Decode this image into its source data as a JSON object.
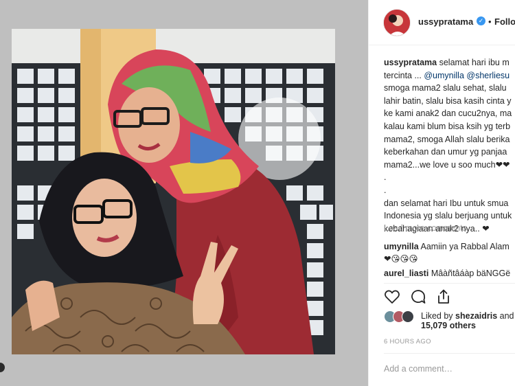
{
  "header": {
    "username": "ussypratama",
    "separator": "•",
    "follow_label": "Follow"
  },
  "caption": {
    "username": "ussypratama",
    "lines": [
      "selamat hari ibu m",
      "tercinta ... ",
      "smoga mama2 slalu sehat, slalu",
      "lahir batin, slalu bisa kasih cinta y",
      "ke kami anak2 dan cucu2nya, ma",
      "kalau kami blum bisa ksih yg terb",
      "mama2, smoga Allah slalu berika",
      "keberkahan dan umur yg panjaa",
      "mama2...we love u soo much❤❤",
      ".",
      ".",
      "dan selamat hari Ibu untuk smua",
      "Indonesia yg slalu berjuang untuk",
      "kebahagiaan anak2 nya.. ❤"
    ],
    "mentions": [
      "@umynilla",
      "@sherliesu"
    ]
  },
  "load_more_label": "Load more comments",
  "comments": [
    {
      "user": "umynilla",
      "text": "Aamiin ya Rabbal Alam",
      "text2": "❤😘😘😘"
    },
    {
      "user": "aurel_liasti",
      "text": "Mâàñtâáàp bäNGGë"
    }
  ],
  "likes": {
    "liked_by_prefix": "Liked by ",
    "liked_by_user": "shezaidris",
    "liked_by_suffix": " and",
    "count_text": "15,079 others"
  },
  "timestamp": "6 HOURS AGO",
  "comment_input": {
    "placeholder": "Add a comment…"
  },
  "icons": {
    "like": "heart-outline-icon",
    "comment": "speech-bubble-icon",
    "share": "share-icon",
    "verified": "verified-badge-icon"
  },
  "colors": {
    "verified": "#3897f0",
    "mention": "#003569",
    "muted": "#999999",
    "text": "#262626"
  }
}
